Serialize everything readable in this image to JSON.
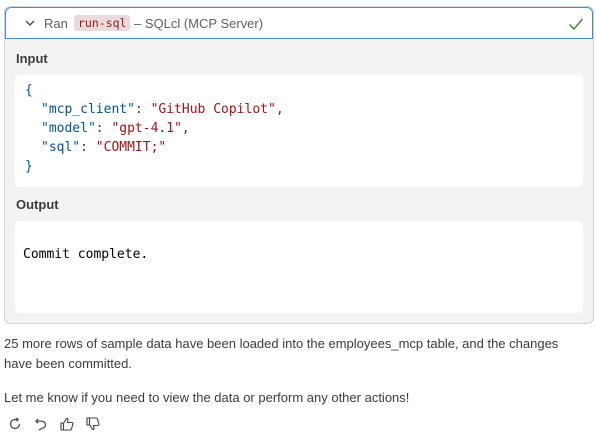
{
  "tool_call": {
    "ran_label": "Ran",
    "tool_name": "run-sql",
    "description": "– SQLcl (MCP Server)",
    "input_label": "Input",
    "output_label": "Output",
    "input_json": {
      "open_brace": "{",
      "close_brace": "}",
      "lines": [
        {
          "key": "\"mcp_client\"",
          "value": "\"GitHub Copilot\"",
          "trail": ","
        },
        {
          "key": "\"model\"",
          "value": "\"gpt-4.1\"",
          "trail": ","
        },
        {
          "key": "\"sql\"",
          "value": "\"COMMIT;\"",
          "trail": ""
        }
      ]
    },
    "output_text": "Commit complete.",
    "status_icon": "check-icon",
    "colors": {
      "accent": "#3c8ce0",
      "success": "#388a34",
      "string": "#a31515",
      "key": "#0451a5"
    }
  },
  "message": {
    "paragraph_1": "25 more rows of sample data have been loaded into the employees_mcp table, and the changes have been committed.",
    "paragraph_2": "Let me know if you need to view the data or perform any other actions!"
  },
  "actions": [
    {
      "icon": "retry-icon"
    },
    {
      "icon": "undo-icon"
    },
    {
      "icon": "thumbs-up-icon"
    },
    {
      "icon": "thumbs-down-icon"
    }
  ]
}
